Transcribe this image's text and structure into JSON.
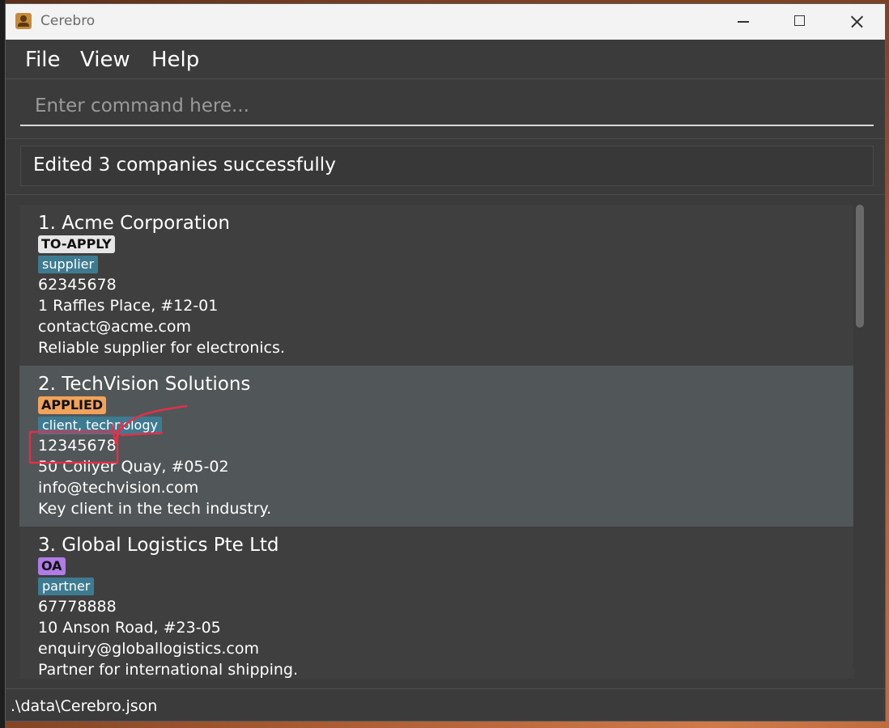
{
  "window": {
    "title": "Cerebro",
    "app_icon": "contact-card-icon",
    "controls": {
      "minimize": "minimize-icon",
      "maximize": "maximize-icon",
      "close": "close-icon"
    }
  },
  "menu": {
    "items": [
      "File",
      "View",
      "Help"
    ]
  },
  "command": {
    "placeholder": "Enter command here...",
    "value": ""
  },
  "result": {
    "message": "Edited 3 companies successfully"
  },
  "companies": [
    {
      "name": "1. Acme Corporation",
      "status": "TO-APPLY",
      "status_color": "#e6e6e6",
      "tags": [
        "supplier"
      ],
      "phone": "62345678",
      "address": "1 Raffles Place, #12-01",
      "email": "contact@acme.com",
      "description": "Reliable supplier for electronics."
    },
    {
      "name": "2. TechVision Solutions",
      "status": "APPLIED",
      "status_color": "#f0a35a",
      "tags": [
        "client, technology"
      ],
      "phone": "12345678",
      "address": "50 Collyer Quay, #05-02",
      "email": "info@techvision.com",
      "description": "Key client in the tech industry."
    },
    {
      "name": "3. Global Logistics Pte Ltd",
      "status": "OA",
      "status_color": "#b07ce6",
      "tags": [
        "partner"
      ],
      "phone": "67778888",
      "address": "10 Anson Road, #23-05",
      "email": "enquiry@globallogistics.com",
      "description": "Partner for international shipping."
    }
  ],
  "status_bar": {
    "path": ".\\data\\Cerebro.json"
  },
  "colors": {
    "window_bg": "#3b3b3b",
    "selected_card_bg": "#515658",
    "tag_bg": "#3e7b91",
    "annotation_red": "#e0304a"
  }
}
